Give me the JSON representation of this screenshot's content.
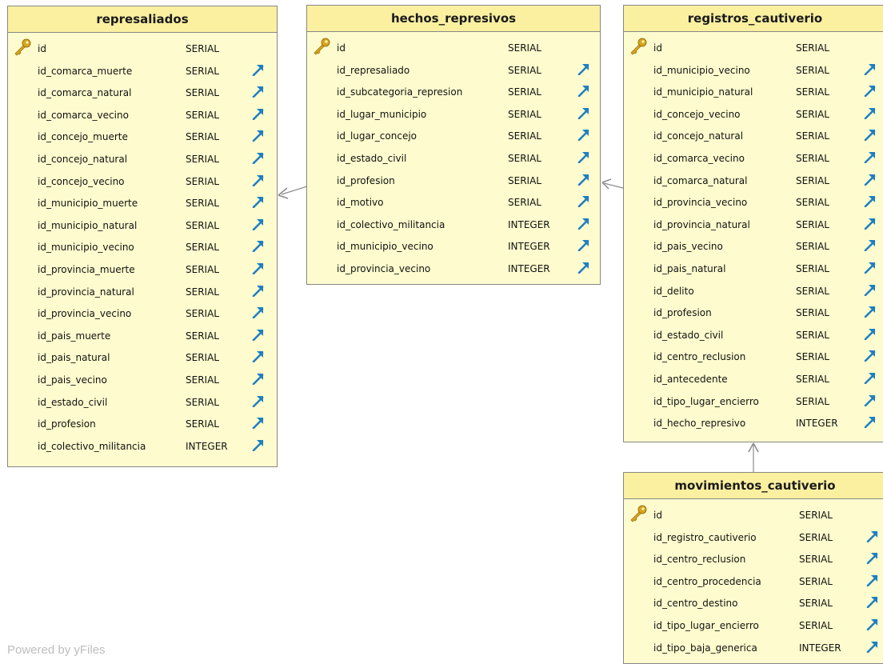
{
  "footer": {
    "powered_by": "Powered by yFiles"
  },
  "colors": {
    "table_fill": "#fefcce",
    "header_fill": "#fbf0a0",
    "border": "#868686",
    "fk_arrow": "#1f7fc2",
    "key": "#d9a520",
    "edge": "#8a8a8a"
  },
  "icons": {
    "primary_key": "key-icon",
    "foreign_key": "fk-arrow-icon"
  },
  "tables": [
    {
      "id": "represaliados",
      "title": "represaliados",
      "fields": [
        {
          "name": "id",
          "type": "SERIAL",
          "pk": true
        },
        {
          "name": "id_comarca_muerte",
          "type": "SERIAL",
          "fk": true
        },
        {
          "name": "id_comarca_natural",
          "type": "SERIAL",
          "fk": true
        },
        {
          "name": "id_comarca_vecino",
          "type": "SERIAL",
          "fk": true
        },
        {
          "name": "id_concejo_muerte",
          "type": "SERIAL",
          "fk": true
        },
        {
          "name": "id_concejo_natural",
          "type": "SERIAL",
          "fk": true
        },
        {
          "name": "id_concejo_vecino",
          "type": "SERIAL",
          "fk": true
        },
        {
          "name": "id_municipio_muerte",
          "type": "SERIAL",
          "fk": true
        },
        {
          "name": "id_municipio_natural",
          "type": "SERIAL",
          "fk": true
        },
        {
          "name": "id_municipio_vecino",
          "type": "SERIAL",
          "fk": true
        },
        {
          "name": "id_provincia_muerte",
          "type": "SERIAL",
          "fk": true
        },
        {
          "name": "id_provincia_natural",
          "type": "SERIAL",
          "fk": true
        },
        {
          "name": "id_provincia_vecino",
          "type": "SERIAL",
          "fk": true
        },
        {
          "name": "id_pais_muerte",
          "type": "SERIAL",
          "fk": true
        },
        {
          "name": "id_pais_natural",
          "type": "SERIAL",
          "fk": true
        },
        {
          "name": "id_pais_vecino",
          "type": "SERIAL",
          "fk": true
        },
        {
          "name": "id_estado_civil",
          "type": "SERIAL",
          "fk": true
        },
        {
          "name": "id_profesion",
          "type": "SERIAL",
          "fk": true
        },
        {
          "name": "id_colectivo_militancia",
          "type": "INTEGER",
          "fk": true
        }
      ]
    },
    {
      "id": "hechos_represivos",
      "title": "hechos_represivos",
      "fields": [
        {
          "name": "id",
          "type": "SERIAL",
          "pk": true
        },
        {
          "name": "id_represaliado",
          "type": "SERIAL",
          "fk": true
        },
        {
          "name": "id_subcategoria_represion",
          "type": "SERIAL",
          "fk": true
        },
        {
          "name": "id_lugar_municipio",
          "type": "SERIAL",
          "fk": true
        },
        {
          "name": "id_lugar_concejo",
          "type": "SERIAL",
          "fk": true
        },
        {
          "name": "id_estado_civil",
          "type": "SERIAL",
          "fk": true
        },
        {
          "name": "id_profesion",
          "type": "SERIAL",
          "fk": true
        },
        {
          "name": "id_motivo",
          "type": "SERIAL",
          "fk": true
        },
        {
          "name": "id_colectivo_militancia",
          "type": "INTEGER",
          "fk": true
        },
        {
          "name": "id_municipio_vecino",
          "type": "INTEGER",
          "fk": true
        },
        {
          "name": "id_provincia_vecino",
          "type": "INTEGER",
          "fk": true
        }
      ]
    },
    {
      "id": "registros_cautiverio",
      "title": "registros_cautiverio",
      "fields": [
        {
          "name": "id",
          "type": "SERIAL",
          "pk": true
        },
        {
          "name": "id_municipio_vecino",
          "type": "SERIAL",
          "fk": true
        },
        {
          "name": "id_municipio_natural",
          "type": "SERIAL",
          "fk": true
        },
        {
          "name": "id_concejo_vecino",
          "type": "SERIAL",
          "fk": true
        },
        {
          "name": "id_concejo_natural",
          "type": "SERIAL",
          "fk": true
        },
        {
          "name": "id_comarca_vecino",
          "type": "SERIAL",
          "fk": true
        },
        {
          "name": "id_comarca_natural",
          "type": "SERIAL",
          "fk": true
        },
        {
          "name": "id_provincia_vecino",
          "type": "SERIAL",
          "fk": true
        },
        {
          "name": "id_provincia_natural",
          "type": "SERIAL",
          "fk": true
        },
        {
          "name": "id_pais_vecino",
          "type": "SERIAL",
          "fk": true
        },
        {
          "name": "id_pais_natural",
          "type": "SERIAL",
          "fk": true
        },
        {
          "name": "id_delito",
          "type": "SERIAL",
          "fk": true
        },
        {
          "name": "id_profesion",
          "type": "SERIAL",
          "fk": true
        },
        {
          "name": "id_estado_civil",
          "type": "SERIAL",
          "fk": true
        },
        {
          "name": "id_centro_reclusion",
          "type": "SERIAL",
          "fk": true
        },
        {
          "name": "id_antecedente",
          "type": "SERIAL",
          "fk": true
        },
        {
          "name": "id_tipo_lugar_encierro",
          "type": "SERIAL",
          "fk": true
        },
        {
          "name": "id_hecho_represivo",
          "type": "INTEGER",
          "fk": true
        }
      ]
    },
    {
      "id": "movimientos_cautiverio",
      "title": "movimientos_cautiverio",
      "fields": [
        {
          "name": "id",
          "type": "SERIAL",
          "pk": true
        },
        {
          "name": "id_registro_cautiverio",
          "type": "SERIAL",
          "fk": true
        },
        {
          "name": "id_centro_reclusion",
          "type": "SERIAL",
          "fk": true
        },
        {
          "name": "id_centro_procedencia",
          "type": "SERIAL",
          "fk": true
        },
        {
          "name": "id_centro_destino",
          "type": "SERIAL",
          "fk": true
        },
        {
          "name": "id_tipo_lugar_encierro",
          "type": "SERIAL",
          "fk": true
        },
        {
          "name": "id_tipo_baja_generica",
          "type": "INTEGER",
          "fk": true
        }
      ]
    }
  ]
}
